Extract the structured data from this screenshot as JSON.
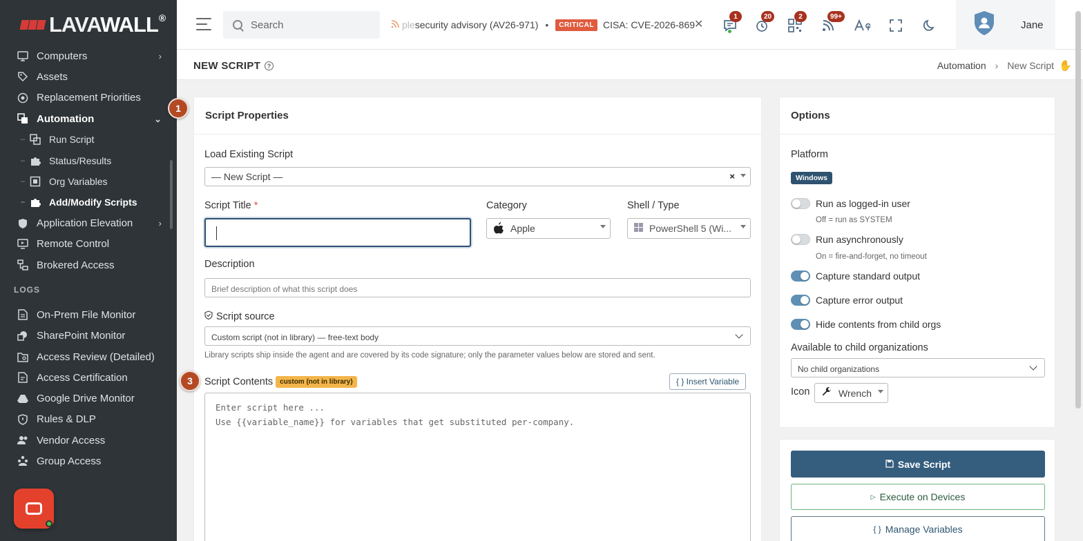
{
  "brand": {
    "name_part1": "LAVA",
    "name_part2": "WALL",
    "reg": "®"
  },
  "sidebar": {
    "items": [
      {
        "label": "Computers",
        "icon": "monitor-icon"
      },
      {
        "label": "Assets",
        "icon": "tag-icon"
      },
      {
        "label": "Replacement Priorities",
        "icon": "cycle-icon"
      },
      {
        "label": "Automation",
        "icon": "automation-icon"
      }
    ],
    "automation_children": [
      {
        "label": "Run Script"
      },
      {
        "label": "Status/Results"
      },
      {
        "label": "Org Variables"
      },
      {
        "label": "Add/Modify Scripts"
      }
    ],
    "items2": [
      {
        "label": "Application Elevation"
      },
      {
        "label": "Remote Control"
      },
      {
        "label": "Brokered Access"
      }
    ],
    "logs_label": "LOGS",
    "logs": [
      {
        "label": "On-Prem File Monitor"
      },
      {
        "label": "SharePoint Monitor"
      },
      {
        "label": "Access Review (Detailed)"
      },
      {
        "label": "Access Certification"
      },
      {
        "label": "Google Drive Monitor"
      },
      {
        "label": "Rules & DLP"
      },
      {
        "label": "Vendor Access"
      },
      {
        "label": "Group Access"
      }
    ]
  },
  "topbar": {
    "search_placeholder": "Search",
    "ticker_fade": "ple",
    "ticker_text1": " security advisory (AV26-971)",
    "ticker_sep": "•",
    "critical_label": "CRITICAL",
    "ticker_text2": "CISA: CVE-2026-869",
    "ticker_close": "✕",
    "badges": {
      "messages": "1",
      "history": "20",
      "qr": "2",
      "feeds": "99+"
    },
    "user_name": "Jane"
  },
  "header": {
    "title": "NEW SCRIPT",
    "breadcrumb": [
      "Automation",
      "New Script"
    ],
    "breadcrumb_sep": "›"
  },
  "steps": {
    "one": "1",
    "three": "3"
  },
  "script_properties": {
    "heading": "Script Properties",
    "load_label": "Load Existing Script",
    "load_value": "— New Script —",
    "title_label": "Script Title",
    "required_mark": "*",
    "category_label": "Category",
    "category_value": "Apple",
    "shell_label": "Shell / Type",
    "shell_value": "PowerShell 5 (Wi...",
    "desc_label": "Description",
    "desc_placeholder": "Brief description of what this script does",
    "source_label": "Script source",
    "source_value": "Custom script (not in library) — free-text body",
    "source_hint": "Library scripts ship inside the agent and are covered by its code signature; only the parameter values below are stored and sent.",
    "contents_label": "Script Contents",
    "contents_tag": "custom (not in library)",
    "insert_variable": "{ } Insert Variable",
    "code_placeholder_line1": "Enter script here ...",
    "code_placeholder_line2": "Use {{variable_name}} for variables that get substituted per-company."
  },
  "options": {
    "heading": "Options",
    "platform_label": "Platform",
    "platform_value": "Windows",
    "toggles": [
      {
        "label": "Run as logged-in user",
        "on": false,
        "hint": "Off = run as SYSTEM"
      },
      {
        "label": "Run asynchronously",
        "on": false,
        "hint": "On = fire-and-forget, no timeout"
      },
      {
        "label": "Capture standard output",
        "on": true
      },
      {
        "label": "Capture error output",
        "on": true
      },
      {
        "label": "Hide contents from child orgs",
        "on": true
      }
    ],
    "child_orgs_label": "Available to child organizations",
    "child_orgs_value": "No child organizations",
    "icon_label": "Icon",
    "icon_value": "Wrench"
  },
  "actions": {
    "save": "Save Script",
    "execute": "Execute on Devices",
    "manage": "Manage Variables"
  },
  "colors": {
    "sidebar_bg": "#2e3437",
    "primary": "#345d7e",
    "critical": "#e05b3e",
    "badge": "#a83220",
    "accent_brand": "#d63b37"
  }
}
